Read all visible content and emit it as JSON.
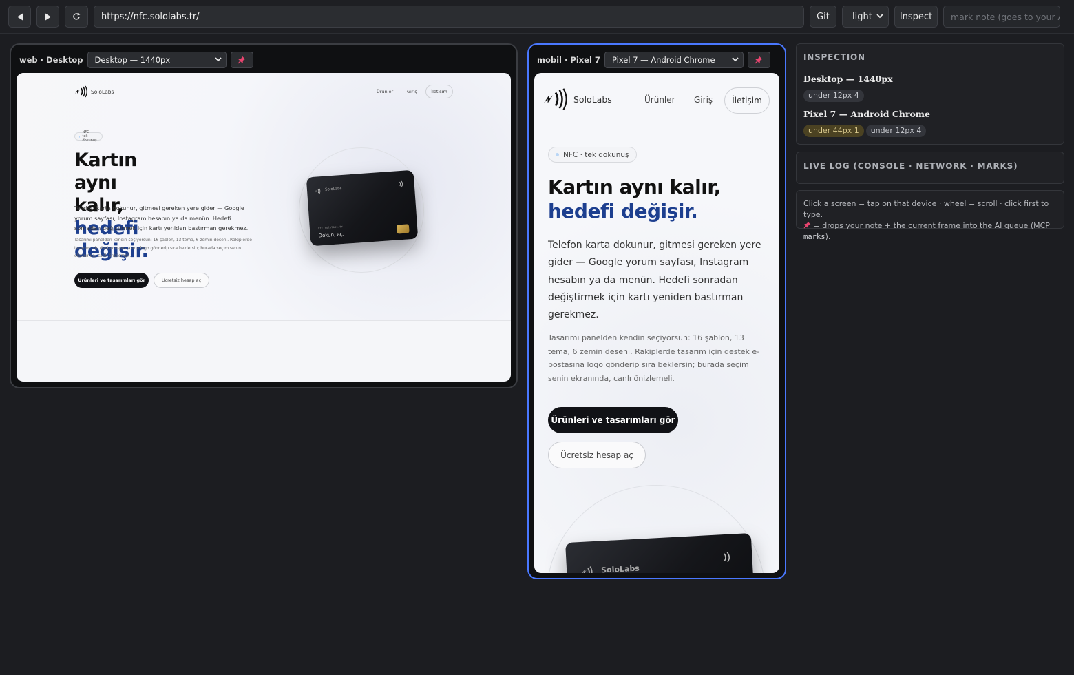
{
  "toolbar": {
    "back": "◀",
    "forward": "▶",
    "reload": "⟳",
    "url": "https://nfc.sololabs.tr/",
    "git": "Git",
    "theme": "light",
    "inspect": "Inspect",
    "note_placeholder": "mark note (goes to your AI)"
  },
  "desktop_panel": {
    "tag_prefix": "web · ",
    "tag_name": "Desktop",
    "device": "Desktop — 1440px"
  },
  "mobile_panel": {
    "tag_prefix": "mobil · ",
    "tag_name": "Pixel 7",
    "device": "Pixel 7 — Android Chrome"
  },
  "site": {
    "brand": "SoloLabs",
    "nav": [
      "Ürünler",
      "Giriş",
      "İletişim"
    ],
    "badge": "NFC · tek dokunuş",
    "headline_1": "Kartın aynı kalır,",
    "headline_2": "hedefi değişir.",
    "lead": "Telefon karta dokunur, gitmesi gereken yere gider — Google yorum sayfası, Instagram hesabın ya da menün. Hedefi sonradan değiştirmek için kartı yeniden bastırman gerekmez.",
    "sub": "Tasarımı panelden kendin seçiyorsun: 16 şablon, 13 tema, 6 zemin deseni. Rakiplerde tasarım için destek e-postasına logo gönderip sıra beklersin; burada seçim senin ekranında, canlı önizlemeli.",
    "cta_primary": "Ürünleri ve tasarımları gör",
    "cta_secondary": "Ücretsiz hesap aç",
    "card_brand": "SoloLabs",
    "card_url": "nfc.sololabs.tr",
    "card_tagline": "Dokun, aç."
  },
  "inspection": {
    "title": "INSPECTION",
    "devices": [
      {
        "name": "Desktop — 1440px",
        "tags": [
          "under 12px 4"
        ]
      },
      {
        "name": "Pixel 7 — Android Chrome",
        "tags": [
          "under 44px 1",
          "under 12px 4"
        ]
      }
    ]
  },
  "live_log": {
    "title": "LIVE LOG (CONSOLE · NETWORK · MARKS)"
  },
  "help": {
    "line1": "Click a screen = tap on that device · wheel = scroll · click first to type.",
    "line2_pre": " = drops your note + the current frame into the AI queue (MCP ",
    "line2_code": "marks",
    "line2_post": ")."
  },
  "colors": {
    "accent": "#4a78ff",
    "pin": "#e8456f",
    "warn_tag": "#4b4222",
    "headline_blue": "#1d3f8f"
  },
  "icons": [
    "back-icon",
    "forward-icon",
    "reload-icon",
    "chevron-down-icon",
    "pin-icon",
    "nfc-icon",
    "contactless-icon"
  ]
}
